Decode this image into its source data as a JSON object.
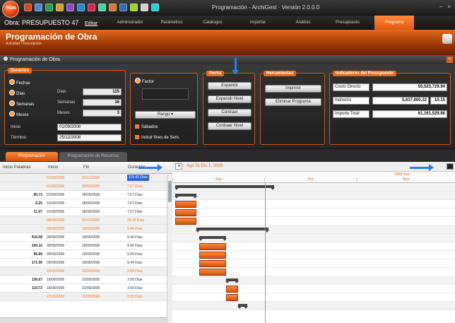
{
  "window": {
    "title": "Programación - ArchiGest · Versión 2.0.0.0",
    "logo_text": "ITEMS",
    "controls": [
      "–",
      "×"
    ]
  },
  "quick_icons": [
    "#d04a2a",
    "#4a8ad0",
    "#2aa04a",
    "#d0a02a",
    "#8a4ad0",
    "#2a8ad0",
    "#d02a4a",
    "#4ad0a0",
    "#d07a2a",
    "#3a6ab0",
    "#a0d02a",
    "#d0d0d0",
    "#2ad0d0"
  ],
  "menubar": {
    "obra": "Obra: PRESUPUESTO 47",
    "link": "Editar",
    "tabs": [
      "Administrador",
      "Parámetros",
      "Catálogos",
      "Importar",
      "Análisis",
      "Presupuesto",
      "Programa"
    ],
    "active_tab": "Programa"
  },
  "module": {
    "title": "Programación de Obra",
    "subtitle": "Actividad / Descripción",
    "panel_caption": "Programación de Obra"
  },
  "duracion": {
    "title": "Duración",
    "fechas": "Fechas",
    "rows": [
      {
        "option": "Días",
        "label": "Días",
        "value": "115"
      },
      {
        "option": "Semanas",
        "label": "Semanas",
        "value": "16"
      },
      {
        "option": "Meses",
        "label": "Meses",
        "value": "3"
      }
    ],
    "inicio_label": "Inicio",
    "inicio": "01/09/2008",
    "termino_label": "Término",
    "termino": "25/12/2008"
  },
  "factor": {
    "title": "Factor",
    "value": "",
    "select_label": "Rango",
    "check1": "Sábados",
    "check2": "Incluir fines de Sem."
  },
  "fecha": {
    "title": "Fecha",
    "buttons": [
      "Expandir",
      "Expandir Nivel",
      "Contraer",
      "Contraer Nivel"
    ]
  },
  "herramientas": {
    "title": "Herramientas",
    "buttons": [
      "Imprimir",
      "Eliminar Programa"
    ]
  },
  "indicadores": {
    "title": "Indicadores del Presupuesto",
    "rows": [
      {
        "label": "Costo Directo",
        "value": "55,523,729.94"
      },
      {
        "label": "Indirecto",
        "value": "5,637,800.32",
        "extra": "10.15"
      },
      {
        "label": "Importe Total",
        "value": "61,161,529.86"
      }
    ]
  },
  "bottom_tabs": [
    "Programación",
    "Programación de Recursos"
  ],
  "grid": {
    "headers": [
      "Inicio Palabras",
      "Inicio",
      "Fin",
      "Duración"
    ],
    "rows": [
      {
        "amount": "",
        "start": "01/09/2008",
        "end": "25/12/2008",
        "dur": "115.42 Días",
        "type": "summary-sel"
      },
      {
        "amount": "",
        "start": "01/09/2008",
        "end": "08/09/2008",
        "dur": "7.67 Días",
        "type": "summary"
      },
      {
        "amount": "96.73",
        "start": "01/09/2008",
        "end": "08/09/2008",
        "dur": "7.67 Días",
        "type": "task"
      },
      {
        "amount": "8.26",
        "start": "01/09/2008",
        "end": "08/09/2008",
        "dur": "7.67 Días",
        "type": "task"
      },
      {
        "amount": "21.97",
        "start": "01/09/2008",
        "end": "08/09/2008",
        "dur": "7.67 Días",
        "type": "task"
      },
      {
        "amount": "",
        "start": "08/09/2008",
        "end": "02/10/2008",
        "dur": "24.33 Días",
        "type": "summary"
      },
      {
        "amount": "",
        "start": "09/09/2008",
        "end": "18/09/2008",
        "dur": "9.44 Días",
        "type": "summary"
      },
      {
        "amount": "916.68",
        "start": "09/09/2008",
        "end": "18/09/2008",
        "dur": "9.44 Días",
        "type": "task"
      },
      {
        "amount": "169.16",
        "start": "09/09/2008",
        "end": "18/09/2008",
        "dur": "9.44 Días",
        "type": "task"
      },
      {
        "amount": "86.89",
        "start": "09/09/2008",
        "end": "18/09/2008",
        "dur": "9.44 Días",
        "type": "task"
      },
      {
        "amount": "171.96",
        "start": "09/09/2008",
        "end": "18/09/2008",
        "dur": "9.44 Días",
        "type": "task"
      },
      {
        "amount": "",
        "start": "18/09/2008",
        "end": "22/09/2008",
        "dur": "3.59 Días",
        "type": "summary"
      },
      {
        "amount": "136.67",
        "start": "18/09/2008",
        "end": "22/09/2008",
        "dur": "3.59 Días",
        "type": "task"
      },
      {
        "amount": "119.72",
        "start": "18/09/2008",
        "end": "22/09/2008",
        "dur": "3.59 Días",
        "type": "task"
      },
      {
        "amount": "",
        "start": "22/09/2008",
        "end": "25/09/2008",
        "dur": "3.35 Días",
        "type": "summary"
      }
    ]
  },
  "gantt": {
    "range": "Ago 31 Dic 1, 2008",
    "year": "2008 Sep",
    "columns": [
      "Sep",
      "Oct",
      "Nov"
    ]
  }
}
